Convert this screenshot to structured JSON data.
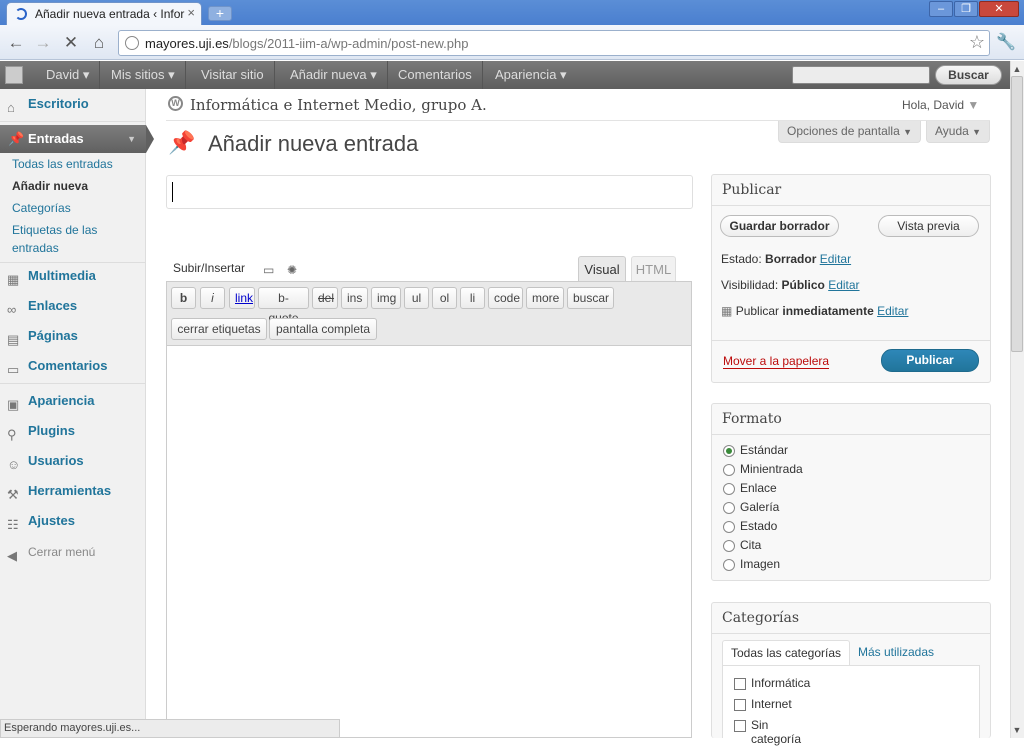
{
  "browser": {
    "tab_title": "Añadir nueva entrada ‹ Inform",
    "url_domain": "mayores.uji.es",
    "url_path": "/blogs/2011-iim-a/wp-admin/post-new.php",
    "status": "Esperando mayores.uji.es..."
  },
  "adminbar": {
    "user": "David",
    "mis_sitios": "Mis sitios",
    "visitar": "Visitar sitio",
    "anadir": "Añadir nueva",
    "comentarios": "Comentarios",
    "apariencia": "Apariencia",
    "buscar": "Buscar"
  },
  "sidebar": {
    "escritorio": "Escritorio",
    "entradas": "Entradas",
    "sub": [
      "Todas las entradas",
      "Añadir nueva",
      "Categorías",
      "Etiquetas de las",
      "entradas"
    ],
    "multimedia": "Multimedia",
    "enlaces": "Enlaces",
    "paginas": "Páginas",
    "comentarios": "Comentarios",
    "apariencia": "Apariencia",
    "plugins": "Plugins",
    "usuarios": "Usuarios",
    "herramientas": "Herramientas",
    "ajustes": "Ajustes",
    "cerrar": "Cerrar menú"
  },
  "header": {
    "site_name": "Informática e Internet Medio, grupo A.",
    "hola": "Hola, David",
    "opciones": "Opciones de pantalla",
    "ayuda": "Ayuda",
    "page_title": "Añadir nueva entrada"
  },
  "editor": {
    "subir": "Subir/Insertar",
    "tab_visual": "Visual",
    "tab_html": "HTML",
    "buttons": [
      "b",
      "i",
      "link",
      "b-quote",
      "del",
      "ins",
      "img",
      "ul",
      "ol",
      "li",
      "code",
      "more",
      "buscar"
    ],
    "buttons2": [
      "cerrar etiquetas",
      "pantalla completa"
    ]
  },
  "publicar": {
    "title": "Publicar",
    "guardar": "Guardar borrador",
    "vista": "Vista previa",
    "estado_label": "Estado:",
    "estado_val": "Borrador",
    "visib_label": "Visibilidad:",
    "visib_val": "Público",
    "pub_label": "Publicar",
    "pub_val": "inmediatamente",
    "editar": "Editar",
    "mover": "Mover a la papelera",
    "publicar_btn": "Publicar"
  },
  "formato": {
    "title": "Formato",
    "options": [
      "Estándar",
      "Minientrada",
      "Enlace",
      "Galería",
      "Estado",
      "Cita",
      "Imagen"
    ],
    "selected": 0
  },
  "categorias": {
    "title": "Categorías",
    "tab_all": "Todas las categorías",
    "tab_used": "Más utilizadas",
    "items": [
      "Informática",
      "Internet",
      "Sin categoría"
    ]
  }
}
